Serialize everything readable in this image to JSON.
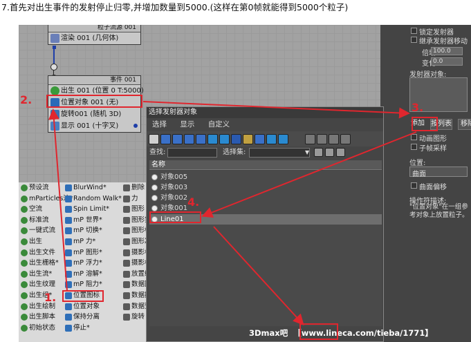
{
  "caption": "7.首先对出生事件的发射停止归零,并增加数量到5000.(这样在第0帧就能得到5000个粒子)",
  "editor": {
    "top_node": {
      "header": "粒子流源 001",
      "row": "渲染 001 (几何体)"
    },
    "event_node": {
      "header": "事件 001",
      "rows": [
        {
          "label": "出生 001 (位置 0 T:5000)",
          "icon": "green-dot-icon"
        },
        {
          "label": "位置对象 001 (无)",
          "icon": "position-object-icon"
        },
        {
          "label": "旋转001 (随机 3D)",
          "icon": "rotation-icon"
        },
        {
          "label": "显示 001 (十字叉)",
          "icon": "display-icon"
        }
      ]
    }
  },
  "right_panel": {
    "top_checks": [
      "锁定发射器",
      "继承发射器移动"
    ],
    "multiplier_label": "倍增 %",
    "multiplier_value": "100.0",
    "variation_label": "变化 %",
    "variation_value": "0.0",
    "emitter_objects_label": "发射器对象:",
    "add_button": "添加",
    "by_list_button": "按列表",
    "remove_button": "移除",
    "anim_shape_label": "动画图形",
    "subframe_label": "子帧采样",
    "position_label": "位置:",
    "position_value": "曲面",
    "surface_offset_label": "曲面偏移",
    "desc_title": "操作符描述:",
    "desc_text": "\"位置对象\"在一组参考对象上放置粒子。"
  },
  "depot": {
    "col1": [
      "预设流",
      "mParticles流*",
      "空流",
      "标准流",
      "一键式流",
      "出生",
      "出生文件",
      "出生栅格*",
      "出生流*",
      "出生纹理",
      "出生组*",
      "出生绘制",
      "出生脚本",
      "初始状态"
    ],
    "col2": [
      "BlurWind*",
      "Random Walk*",
      "Spin Limit*",
      "mP 世界*",
      "mP 切换*",
      "mP 力*",
      "mP 图形*",
      "mP 浮力*",
      "mP 溶解*",
      "mP 阻力*",
      "位置图标",
      "位置对象",
      "保持分离",
      "停止*"
    ],
    "col3": [
      "删除",
      "力",
      "图形",
      "图形实",
      "图形标",
      "图形决",
      "摄影机",
      "摄影机",
      "放置绘",
      "数据图",
      "数据操",
      "数据预",
      "旋转"
    ]
  },
  "dialog": {
    "title": "选择发射器对象",
    "menu": [
      "选择",
      "显示",
      "自定义"
    ],
    "find_label": "查找:",
    "selset_label": "选择集:",
    "list_header": "名称",
    "items": [
      "对象005",
      "对象003",
      "对象002",
      "对象001",
      "Line01"
    ]
  },
  "watermark": {
    "left": "3Dmax吧",
    "url": "【www.lineca.com/tieba/1771】"
  },
  "annotations": [
    "1.",
    "2.",
    "3.",
    "4."
  ],
  "colors": {
    "accent_red": "#e0262e",
    "wire_blue": "#1e3ea8"
  }
}
